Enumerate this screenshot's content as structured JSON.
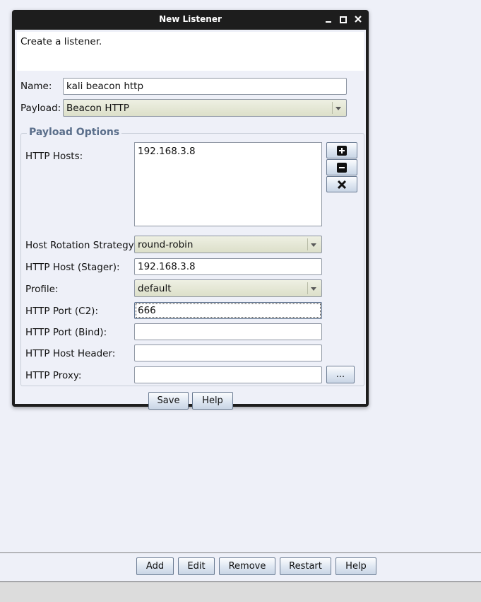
{
  "dialog": {
    "title": "New Listener",
    "description": "Create a listener.",
    "name_label": "Name:",
    "name_value": "kali beacon http",
    "payload_label": "Payload:",
    "payload_value": "Beacon HTTP",
    "options_title": "Payload Options",
    "http_hosts_label": "HTTP Hosts:",
    "http_hosts": [
      "192.168.3.8"
    ],
    "rotation_label": "Host Rotation Strategy:",
    "rotation_value": "round-robin",
    "stager_label": "HTTP Host (Stager):",
    "stager_value": "192.168.3.8",
    "profile_label": "Profile:",
    "profile_value": "default",
    "port_c2_label": "HTTP Port (C2):",
    "port_c2_value": "666",
    "port_bind_label": "HTTP Port (Bind):",
    "port_bind_value": "",
    "host_header_label": "HTTP Host Header:",
    "host_header_value": "",
    "proxy_label": "HTTP Proxy:",
    "proxy_value": "",
    "proxy_button": "...",
    "save_label": "Save",
    "help_label": "Help"
  },
  "bottom_bar": {
    "add_label": "Add",
    "edit_label": "Edit",
    "remove_label": "Remove",
    "restart_label": "Restart",
    "help_label": "Help"
  },
  "icons": {
    "minimize": "minimize-icon",
    "maximize": "maximize-icon",
    "close": "close-icon",
    "add_host": "plus-icon",
    "remove_host": "minus-icon",
    "clear_hosts": "x-icon"
  },
  "colors": {
    "window_background": "#eef0f8",
    "titlebar": "#1d1d1d",
    "group_title": "#5b6f8b",
    "combo_background": "#dcdfc9"
  }
}
